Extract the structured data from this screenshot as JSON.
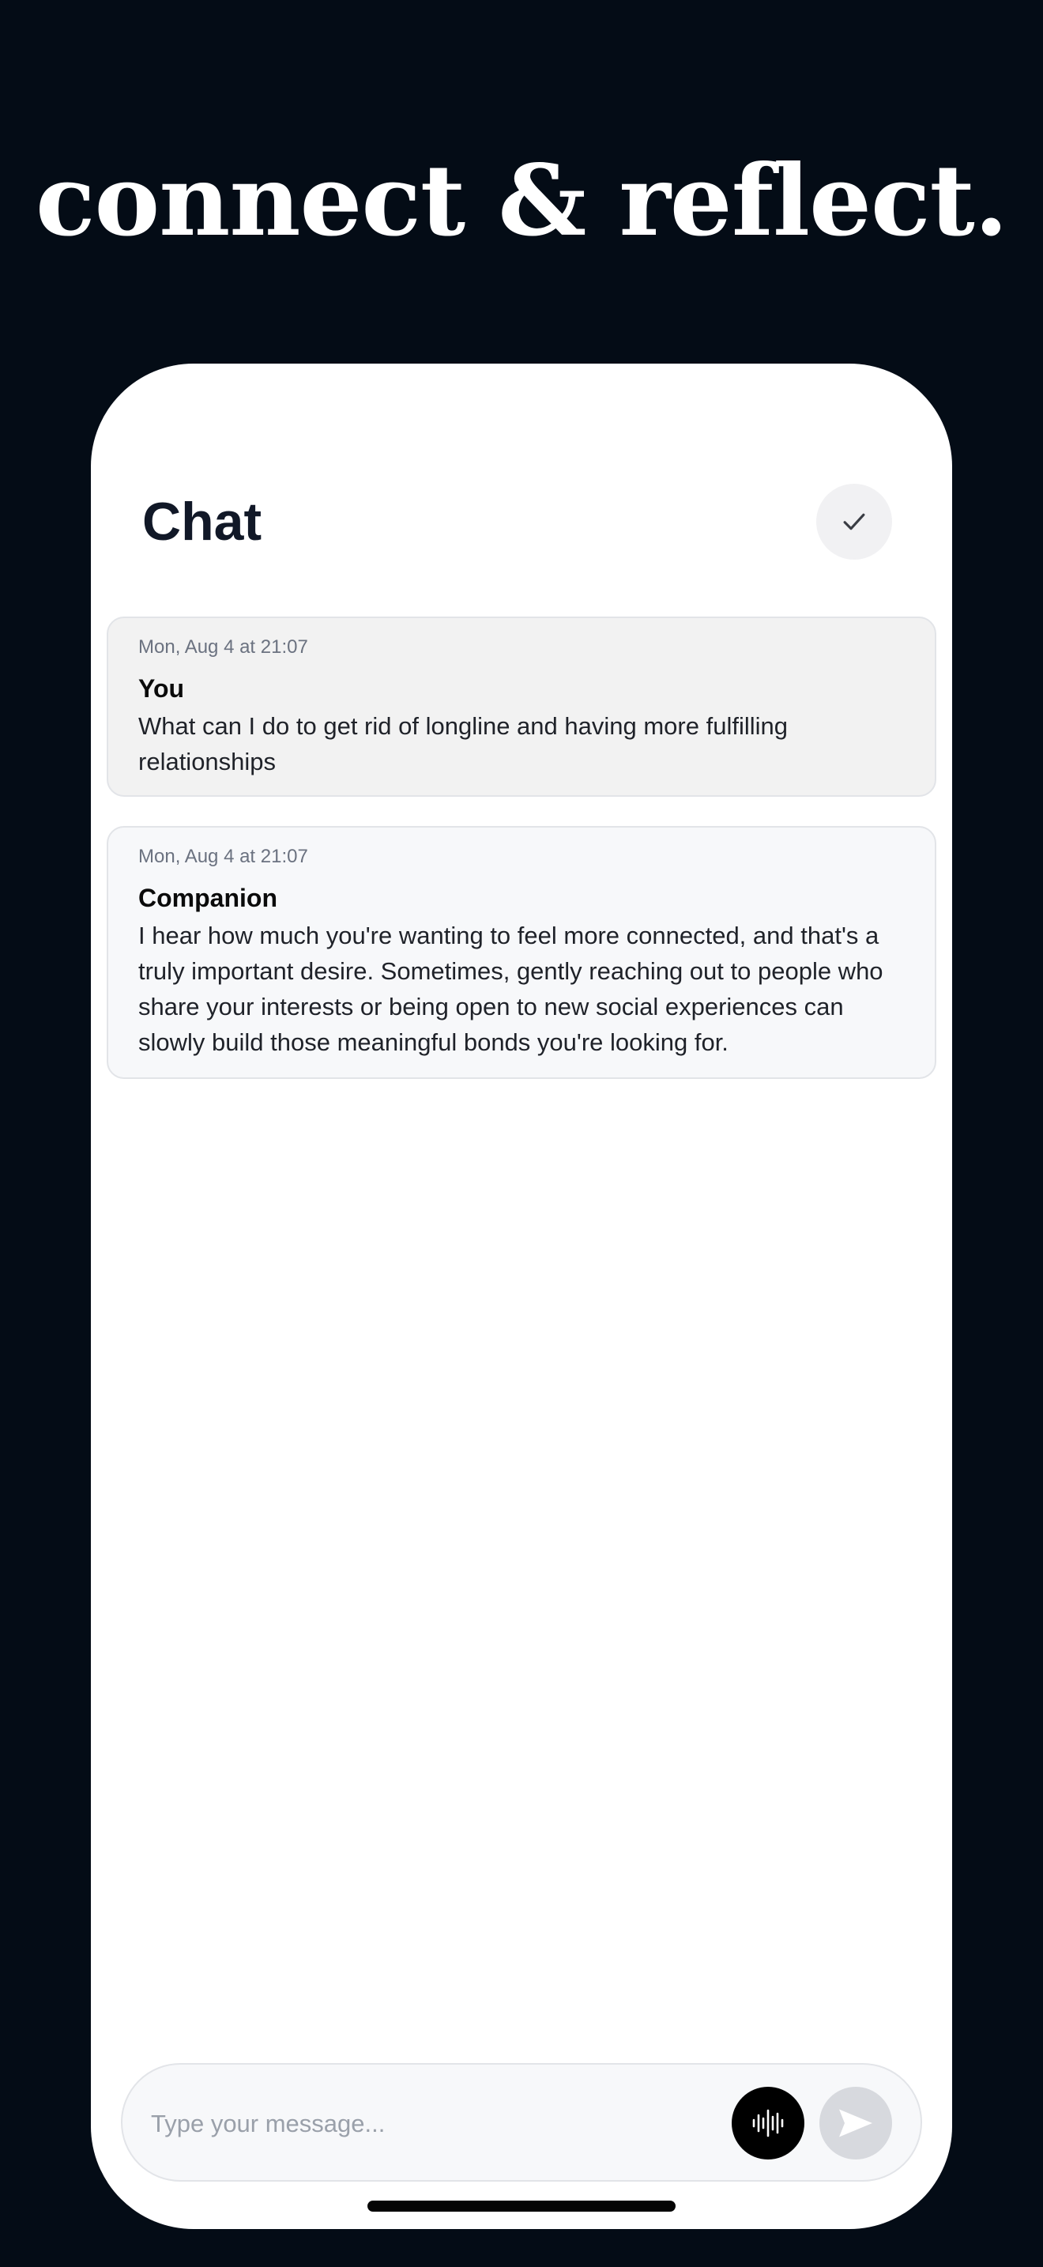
{
  "headline": "connect & reflect.",
  "chat": {
    "title": "Chat",
    "done_icon": "checkmark-icon",
    "messages": [
      {
        "timestamp": "Mon, Aug 4 at 21:07",
        "author": "You",
        "text": "What can I do to get rid of longline and having more fulfilling relationships"
      },
      {
        "timestamp": "Mon, Aug 4 at 21:07",
        "author": "Companion",
        "text": "I hear how much you're wanting to feel more connected, and that's a truly important desire. Sometimes, gently reaching out to people who share your interests or being open to new social experiences can slowly build those meaningful bonds you're looking for."
      }
    ]
  },
  "composer": {
    "placeholder": "Type your message...",
    "value": "",
    "voice_icon": "audio-waveform-icon",
    "send_icon": "send-icon"
  },
  "colors": {
    "background": "#040c16",
    "card": "#ffffff",
    "user_bubble": "#f2f2f2",
    "companion_bubble": "#f7f8fa",
    "voice_button": "#000000",
    "send_button_disabled": "#d7d9de"
  }
}
